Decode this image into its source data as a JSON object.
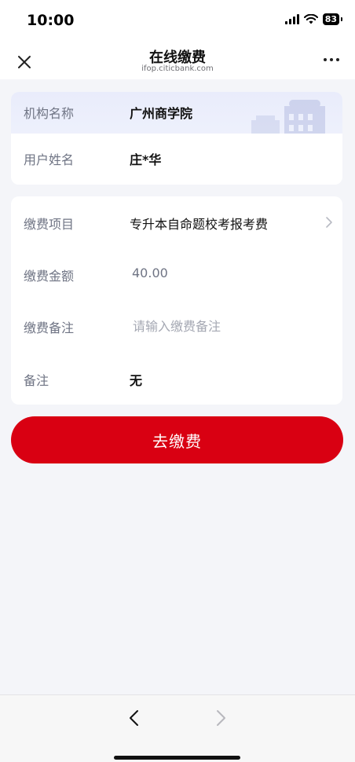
{
  "status_bar": {
    "time": "10:00",
    "battery": "83"
  },
  "nav": {
    "title": "在线缴费",
    "subtitle": "ifop.citicbank.com"
  },
  "info": {
    "org_label": "机构名称",
    "org_value": "广州商学院",
    "user_label": "用户姓名",
    "user_value": "庄*华"
  },
  "payment": {
    "item_label": "缴费项目",
    "item_value": "专升本自命题校考报考费",
    "amount_label": "缴费金额",
    "amount_value": "40.00",
    "note_label": "缴费备注",
    "note_placeholder": "请输入缴费备注",
    "remark_label": "备注",
    "remark_value": "无"
  },
  "actions": {
    "pay_button": "去缴费"
  },
  "colors": {
    "accent": "#d90012",
    "background": "#f4f5f9"
  },
  "icons": [
    "close-icon",
    "more-icon",
    "chevron-right-icon",
    "back-arrow-icon",
    "forward-arrow-icon",
    "wifi-icon",
    "signal-icon",
    "battery-icon"
  ]
}
